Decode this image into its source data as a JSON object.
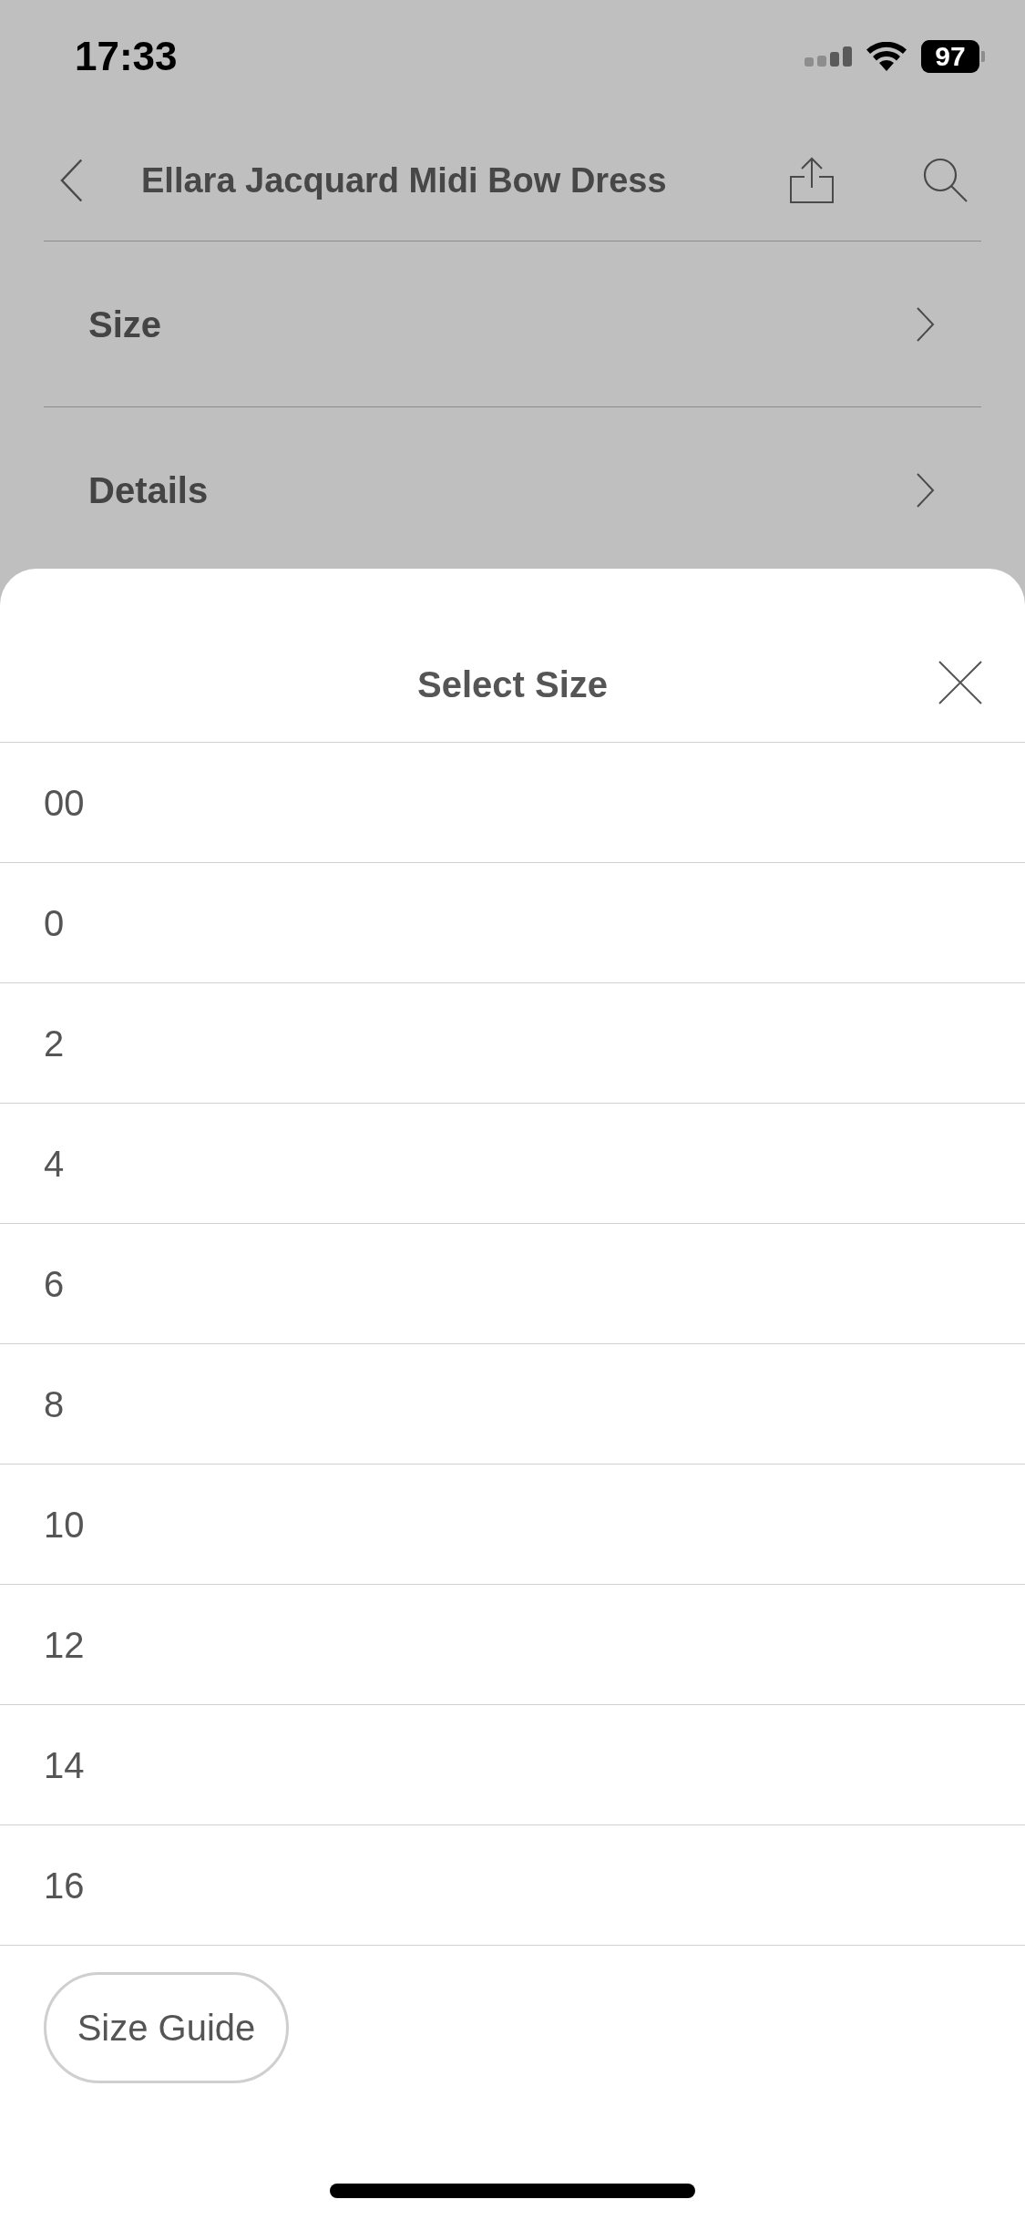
{
  "status_bar": {
    "time": "17:33",
    "battery": "97"
  },
  "nav_bar": {
    "title": "Ellara Jacquard Midi Bow Dress"
  },
  "sections": [
    {
      "label": "Size"
    },
    {
      "label": "Details"
    }
  ],
  "sheet": {
    "title": "Select Size",
    "sizes": [
      "00",
      "0",
      "2",
      "4",
      "6",
      "8",
      "10",
      "12",
      "14",
      "16"
    ],
    "size_guide": "Size Guide"
  }
}
